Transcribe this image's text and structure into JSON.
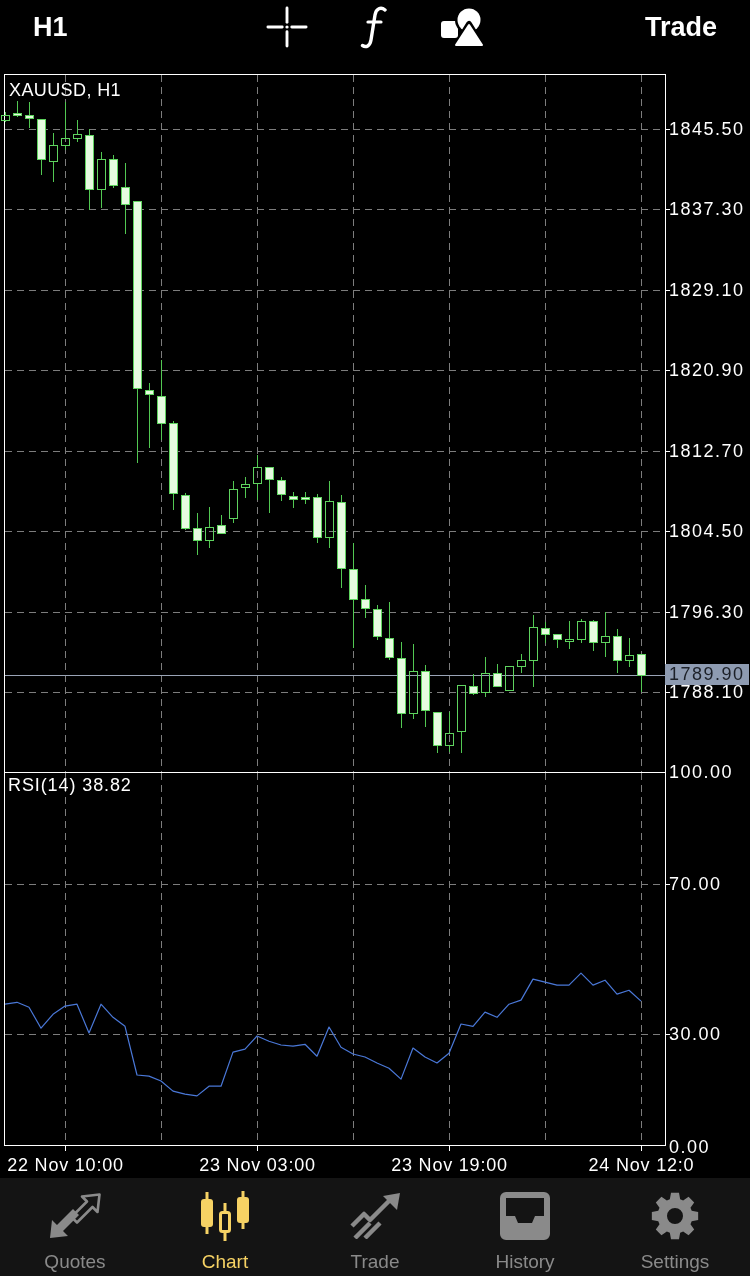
{
  "header": {
    "timeframe": "H1",
    "trade_button": "Trade"
  },
  "price_chart": {
    "chart_data": {
      "type": "candlestick",
      "title": "XAUUSD, H1",
      "grid": true,
      "ylim": [
        1780.0,
        1851.1
      ],
      "ohlc": [
        [
          1846.4,
          1847.2,
          1846.2,
          1846.9
        ],
        [
          1847.1,
          1848.3,
          1846.7,
          1846.9
        ],
        [
          1846.9,
          1848.2,
          1845.6,
          1846.6
        ],
        [
          1846.5,
          1846.5,
          1840.8,
          1842.4
        ],
        [
          1842.2,
          1845.1,
          1840.1,
          1843.9
        ],
        [
          1843.9,
          1848.2,
          1843.4,
          1844.6
        ],
        [
          1844.6,
          1846.4,
          1844.2,
          1845.0
        ],
        [
          1844.9,
          1845.5,
          1837.2,
          1839.4
        ],
        [
          1839.4,
          1843.2,
          1837.5,
          1842.4
        ],
        [
          1842.4,
          1842.8,
          1839.5,
          1839.8
        ],
        [
          1839.6,
          1842.0,
          1834.8,
          1837.9
        ],
        [
          1838.2,
          1838.2,
          1811.5,
          1819.1
        ],
        [
          1818.9,
          1819.6,
          1813.0,
          1818.5
        ],
        [
          1818.3,
          1822.0,
          1813.8,
          1815.5
        ],
        [
          1815.5,
          1815.8,
          1806.7,
          1808.4
        ],
        [
          1808.2,
          1808.4,
          1804.6,
          1804.9
        ],
        [
          1804.9,
          1806.4,
          1802.1,
          1803.6
        ],
        [
          1803.6,
          1807.0,
          1802.8,
          1805.0
        ],
        [
          1805.2,
          1806.2,
          1804.2,
          1804.3
        ],
        [
          1805.9,
          1809.6,
          1805.4,
          1808.8
        ],
        [
          1809.0,
          1810.1,
          1807.9,
          1809.3
        ],
        [
          1809.4,
          1812.3,
          1807.7,
          1811.1
        ],
        [
          1811.1,
          1811.1,
          1806.4,
          1809.8
        ],
        [
          1809.7,
          1810.0,
          1807.6,
          1808.3
        ],
        [
          1808.1,
          1808.5,
          1806.9,
          1807.8
        ],
        [
          1808.0,
          1808.5,
          1807.3,
          1807.8
        ],
        [
          1808.0,
          1808.3,
          1803.3,
          1803.9
        ],
        [
          1803.9,
          1809.6,
          1802.8,
          1807.6
        ],
        [
          1807.5,
          1808.2,
          1798.7,
          1800.8
        ],
        [
          1800.7,
          1803.3,
          1792.6,
          1797.6
        ],
        [
          1797.6,
          1799.0,
          1795.7,
          1796.7
        ],
        [
          1796.6,
          1797.0,
          1793.4,
          1793.9
        ],
        [
          1793.7,
          1797.3,
          1791.4,
          1791.7
        ],
        [
          1791.6,
          1793.2,
          1784.5,
          1786.0
        ],
        [
          1786.0,
          1793.0,
          1785.4,
          1790.3
        ],
        [
          1790.3,
          1790.9,
          1784.6,
          1786.3
        ],
        [
          1786.1,
          1786.1,
          1781.9,
          1782.7
        ],
        [
          1782.8,
          1786.1,
          1782.0,
          1784.0
        ],
        [
          1784.2,
          1788.9,
          1781.9,
          1788.9
        ],
        [
          1788.8,
          1790.0,
          1787.8,
          1788.0
        ],
        [
          1788.1,
          1791.7,
          1787.6,
          1790.1
        ],
        [
          1790.1,
          1791.0,
          1788.7,
          1788.8
        ],
        [
          1788.4,
          1790.8,
          1788.3,
          1790.8
        ],
        [
          1790.8,
          1792.0,
          1790.1,
          1791.4
        ],
        [
          1791.4,
          1796.0,
          1788.7,
          1794.8
        ],
        [
          1794.7,
          1795.3,
          1793.1,
          1794.1
        ],
        [
          1794.1,
          1794.1,
          1792.6,
          1793.5
        ],
        [
          1793.4,
          1795.4,
          1792.5,
          1793.5
        ],
        [
          1793.5,
          1795.6,
          1793.1,
          1795.4
        ],
        [
          1795.4,
          1795.5,
          1792.3,
          1793.2
        ],
        [
          1793.2,
          1796.3,
          1791.7,
          1793.9
        ],
        [
          1793.9,
          1794.6,
          1790.1,
          1791.4
        ],
        [
          1791.4,
          1793.7,
          1790.7,
          1791.9
        ],
        [
          1792.0,
          1792.0,
          1788.1,
          1789.9
        ]
      ],
      "yticks": [
        {
          "value": 1845.5,
          "label": "1845.50"
        },
        {
          "value": 1837.3,
          "label": "1837.30"
        },
        {
          "value": 1829.1,
          "label": "1829.10"
        },
        {
          "value": 1820.9,
          "label": "1820.90"
        },
        {
          "value": 1812.7,
          "label": "1812.70"
        },
        {
          "value": 1804.5,
          "label": "1804.50"
        },
        {
          "value": 1796.3,
          "label": "1796.30"
        },
        {
          "value": 1788.1,
          "label": "1788.10"
        }
      ],
      "ref_lines": [
        {
          "axis": "y",
          "value": 1789.9,
          "label": "1789.90"
        }
      ]
    }
  },
  "indicator": {
    "chart_data": {
      "type": "line",
      "title": "RSI(14) 38.82",
      "grid": true,
      "ylim": [
        0,
        100
      ],
      "categories": [
        null,
        null,
        null,
        null,
        null,
        "22 Nov 10:00",
        null,
        null,
        null,
        null,
        null,
        null,
        null,
        null,
        null,
        null,
        null,
        null,
        null,
        null,
        null,
        "23 Nov 03:00",
        null,
        null,
        null,
        null,
        null,
        null,
        null,
        null,
        null,
        null,
        null,
        null,
        null,
        null,
        null,
        "23 Nov 19:00",
        null,
        null,
        null,
        null,
        null,
        null,
        null,
        null,
        null,
        null,
        null,
        null,
        null,
        null,
        null,
        "24 Nov 12:0"
      ],
      "yticks": [
        {
          "value": 100,
          "label": "100.00"
        },
        {
          "value": 70,
          "label": "70.00"
        },
        {
          "value": 30,
          "label": "30.00"
        },
        {
          "value": 0,
          "label": "0.00"
        }
      ],
      "series": [
        {
          "color": "#4a78d8",
          "values": [
            38.0,
            38.5,
            37.2,
            31.6,
            35.3,
            37.5,
            38.0,
            30.3,
            38.0,
            34.5,
            32.1,
            19.1,
            18.8,
            17.5,
            14.8,
            14.0,
            13.5,
            16.1,
            16.1,
            25.2,
            26.0,
            29.5,
            28.1,
            27.1,
            26.8,
            27.3,
            24.1,
            31.9,
            26.5,
            24.7,
            23.9,
            22.3,
            20.9,
            18.0,
            26.3,
            23.9,
            22.3,
            24.9,
            32.7,
            32.1,
            35.9,
            34.5,
            38.0,
            39.1,
            44.7,
            43.9,
            43.1,
            43.1,
            46.3,
            43.1,
            44.4,
            40.7,
            41.7,
            38.82
          ]
        }
      ]
    }
  },
  "tabs": [
    {
      "label": "Quotes",
      "selected": false
    },
    {
      "label": "Chart",
      "selected": true
    },
    {
      "label": "Trade",
      "selected": false
    },
    {
      "label": "History",
      "selected": false
    },
    {
      "label": "Settings",
      "selected": false
    }
  ]
}
